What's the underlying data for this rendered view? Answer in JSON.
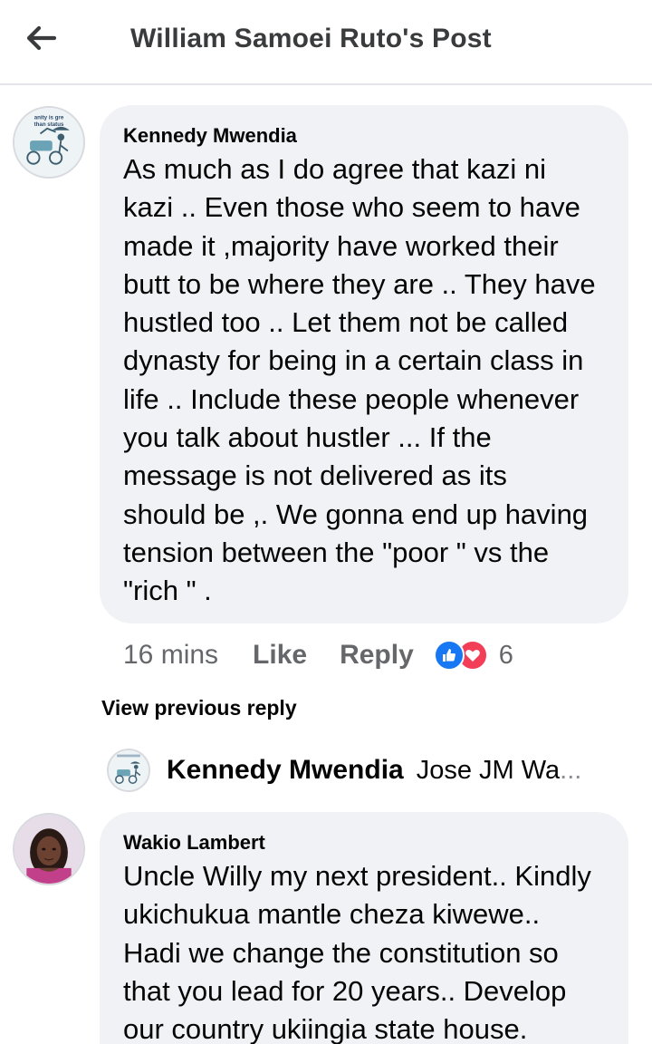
{
  "header": {
    "title": "William Samoei Ruto's Post",
    "back_icon": "back-arrow-icon"
  },
  "comment1": {
    "avatar_text_top": "anity is gre",
    "avatar_text_bottom": "than status",
    "author": "Kennedy Mwendia",
    "lines": [
      "As much as I do agree that kazi ni",
      "kazi .. Even those who seem to have",
      "made it ,majority have worked their",
      "butt to be where they are .. They have",
      "hustled too .. Let them not be called",
      "dynasty for being in a certain class in",
      "life .. Include these people whenever",
      "you talk about hustler ... If the",
      "message is not delivered as its",
      "should be ,. We gonna end up having",
      "tension between the \"poor \" vs the",
      "\"rich \" ."
    ],
    "time": "16 mins",
    "like_label": "Like",
    "reply_label": "Reply",
    "reaction_count": "6",
    "colors": {
      "like": "#1877f2",
      "love": "#f33e58"
    }
  },
  "replies": {
    "view_previous": "View previous reply",
    "preview": {
      "author": "Kennedy Mwendia",
      "snippet": "Jose JM Wa",
      "ellipsis": "..."
    }
  },
  "comment2": {
    "author": "Wakio Lambert",
    "lines": [
      "Uncle Willy my next president.. Kindly",
      "ukichukua mantle cheza kiwewe..",
      "Hadi we change the constitution so",
      "that you lead for 20 years.. Develop",
      "our country ukiingia state house."
    ]
  }
}
